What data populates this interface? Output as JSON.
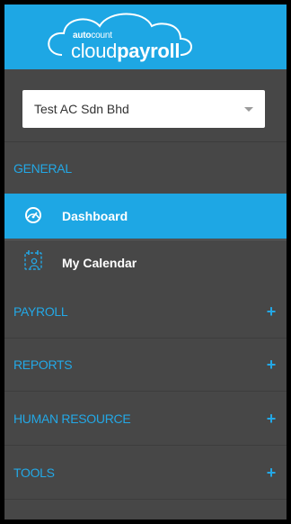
{
  "brand": {
    "small_prefix": "auto",
    "small_suffix": "count",
    "big_prefix": "cloud",
    "big_suffix": "payroll",
    "color": "#1ea7e4"
  },
  "company_select": {
    "value": "Test AC Sdn Bhd",
    "caret_icon": "chevron-down-icon"
  },
  "sidebar": {
    "general_heading": "GENERAL",
    "items": [
      {
        "label": "Dashboard",
        "icon": "dashboard-gauge-icon",
        "active": true
      },
      {
        "label": "My Calendar",
        "icon": "calendar-user-icon",
        "active": false
      }
    ],
    "menus": [
      {
        "label": "PAYROLL",
        "icon": "plus-icon"
      },
      {
        "label": "REPORTS",
        "icon": "plus-icon"
      },
      {
        "label": "HUMAN RESOURCE",
        "icon": "plus-icon"
      },
      {
        "label": "TOOLS",
        "icon": "plus-icon"
      }
    ]
  },
  "colors": {
    "accent": "#1ea7e4",
    "sidebar_bg": "#474747",
    "section_text": "#23a8e6"
  }
}
